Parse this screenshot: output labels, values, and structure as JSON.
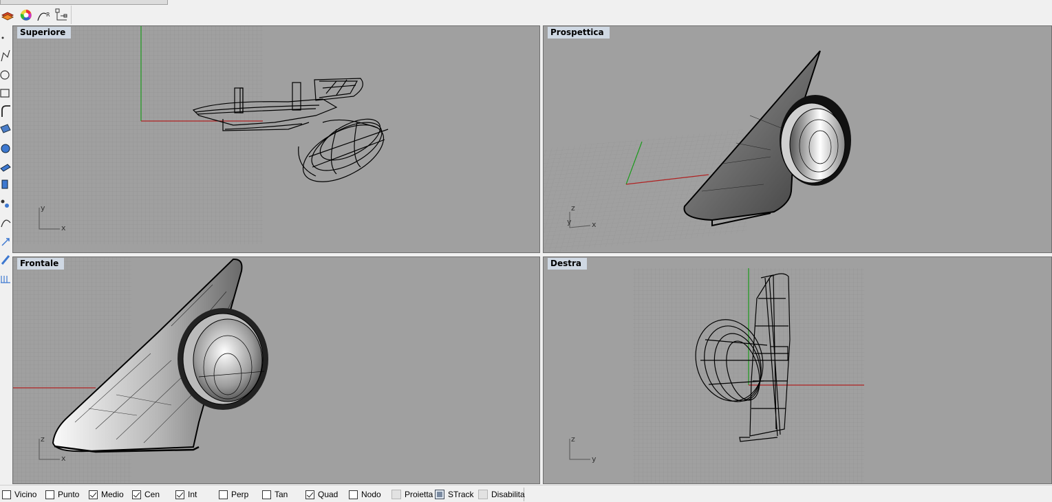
{
  "viewports": {
    "top": {
      "label": "Superiore",
      "axes": [
        "x",
        "y"
      ]
    },
    "perspective": {
      "label": "Prospettica",
      "axes": [
        "x",
        "y",
        "z"
      ]
    },
    "front": {
      "label": "Frontale",
      "axes": [
        "x",
        "z"
      ]
    },
    "right": {
      "label": "Destra",
      "axes": [
        "y",
        "z"
      ]
    }
  },
  "toolbar_top": [
    {
      "icon": "layers-icon"
    },
    {
      "icon": "color-wheel-icon"
    },
    {
      "icon": "curve-tools-icon"
    },
    {
      "icon": "snap-grid-icon"
    }
  ],
  "toolbar_left": [
    "point-icon",
    "polyline-icon",
    "circle-icon",
    "rectangle-icon",
    "fillet-icon",
    "surface-icon",
    "solid-icon",
    "extrude-icon",
    "boolean-icon",
    "array-icon",
    "curve-edit-icon",
    "transform-icon",
    "dimension-icon",
    "grid-icon"
  ],
  "osnap": [
    {
      "label": "Vicino",
      "checked": false,
      "kind": "checkbox"
    },
    {
      "label": "Punto",
      "checked": false,
      "kind": "checkbox"
    },
    {
      "label": "Medio",
      "checked": true,
      "kind": "checkbox"
    },
    {
      "label": "Cen",
      "checked": true,
      "kind": "checkbox"
    },
    {
      "label": "Int",
      "checked": true,
      "kind": "checkbox"
    },
    {
      "label": "Perp",
      "checked": false,
      "kind": "checkbox"
    },
    {
      "label": "Tan",
      "checked": false,
      "kind": "checkbox"
    },
    {
      "label": "Quad",
      "checked": true,
      "kind": "checkbox"
    },
    {
      "label": "Nodo",
      "checked": false,
      "kind": "checkbox"
    },
    {
      "label": "Proietta",
      "checked": false,
      "kind": "toggle"
    },
    {
      "label": "STrack",
      "checked": true,
      "kind": "toggle"
    },
    {
      "label": "Disabilita",
      "checked": false,
      "kind": "toggle"
    }
  ],
  "colors": {
    "viewport_bg": "#a0a0a0",
    "grid_minor": "#8e8e8e",
    "x_axis": "#b02020",
    "y_axis": "#1a9a1a",
    "label_bg": "#cfd8e3"
  }
}
